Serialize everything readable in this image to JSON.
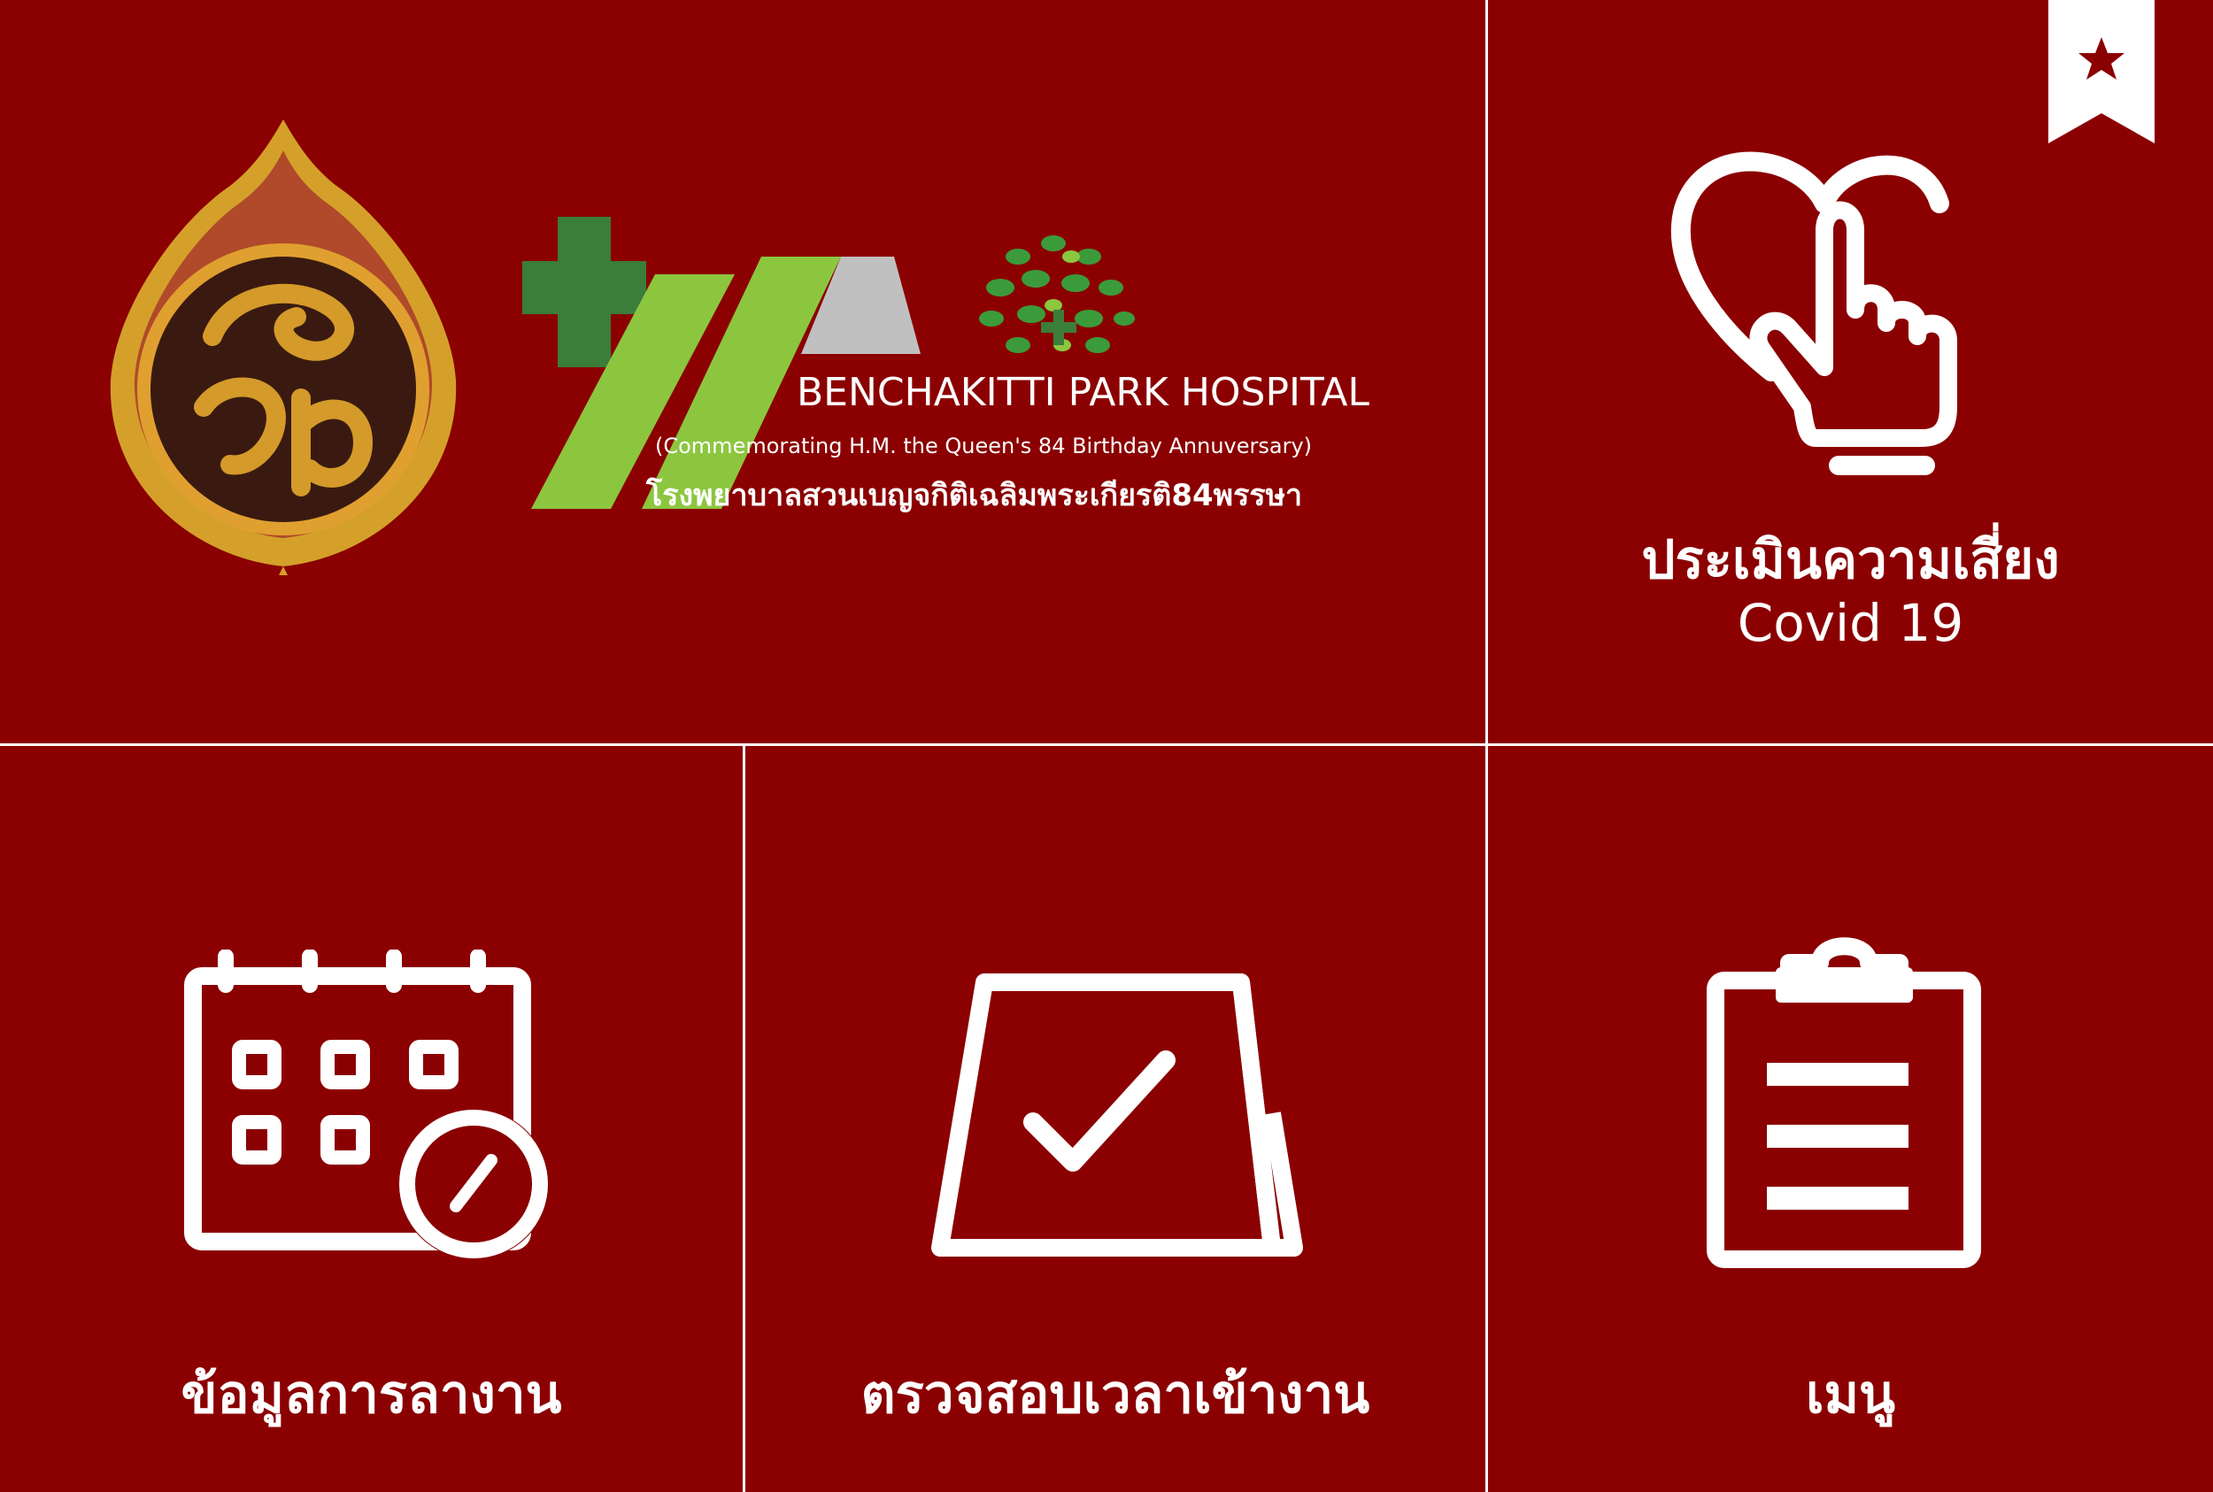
{
  "colors": {
    "background": "#8b0000",
    "grid_line": "#ffffff",
    "gold": "#d4a02a",
    "green_dark": "#3b7d3b",
    "green_light": "#8cc63f",
    "grey": "#c0c0c0"
  },
  "header": {
    "hospital_name_en": "BENCHAKITTI PARK HOSPITAL",
    "hospital_subtitle_en": "(Commemorating H.M. the Queen's 84 Birthday Annuversary)",
    "hospital_name_th": "โรงพยาบาลสวนเบญจกิติเฉลิมพระเกียรติ84พรรษา",
    "emblem_icon": "thai-ministry-emblem-icon",
    "logo_icon": "hospital-cross-logo-icon"
  },
  "tiles": {
    "covid": {
      "label_line1": "ประเมินความเสี่ยง",
      "label_line2": "Covid 19",
      "icon": "heart-hand-icon",
      "bookmark_icon": "bookmark-star-icon"
    },
    "leave": {
      "label": "ข้อมูลการลางาน",
      "icon": "calendar-clock-icon"
    },
    "attendance": {
      "label": "ตรวจสอบเวลาเข้างาน",
      "icon": "calendar-check-icon"
    },
    "menu": {
      "label": "เมนู",
      "icon": "clipboard-list-icon"
    }
  }
}
